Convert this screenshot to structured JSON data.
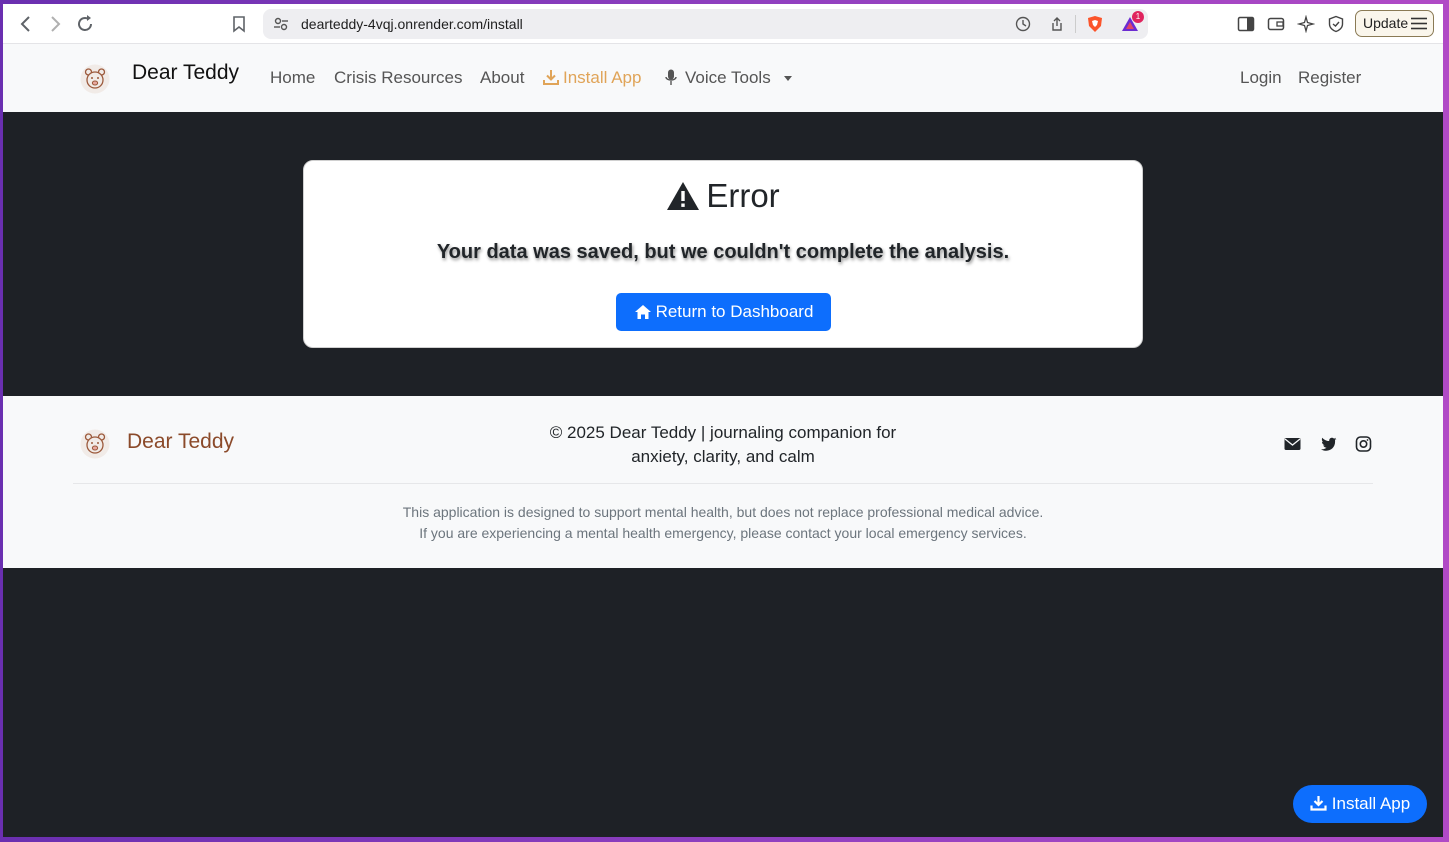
{
  "browser": {
    "url": "dearteddy-4vqj.onrender.com/install",
    "update_label": "Update",
    "notification_count": "1"
  },
  "navbar": {
    "brand": "Dear Teddy",
    "links": {
      "home": "Home",
      "crisis": "Crisis Resources",
      "about": "About",
      "install": "Install App",
      "voice": "Voice Tools"
    },
    "login": "Login",
    "register": "Register",
    "accent_color": "#e0a458"
  },
  "error_card": {
    "title": "Error",
    "message": "Your data was saved, but we couldn't complete the analysis.",
    "button_label": "Return to Dashboard"
  },
  "footer": {
    "brand": "Dear Teddy",
    "copyright_line1": "© 2025 Dear Teddy | journaling companion for",
    "copyright_line2": "anxiety, clarity, and calm",
    "disclaimer_line1": "This application is designed to support mental health, but does not replace professional medical advice.",
    "disclaimer_line2": "If you are experiencing a mental health emergency, please contact your local emergency services.",
    "social_icons": [
      "envelope-icon",
      "twitter-icon",
      "instagram-icon"
    ]
  },
  "install_fab": {
    "label": "Install App"
  },
  "colors": {
    "primary": "#0d6efd",
    "brand_brown": "#8b4a2a",
    "dark_bg": "#1e2126"
  }
}
